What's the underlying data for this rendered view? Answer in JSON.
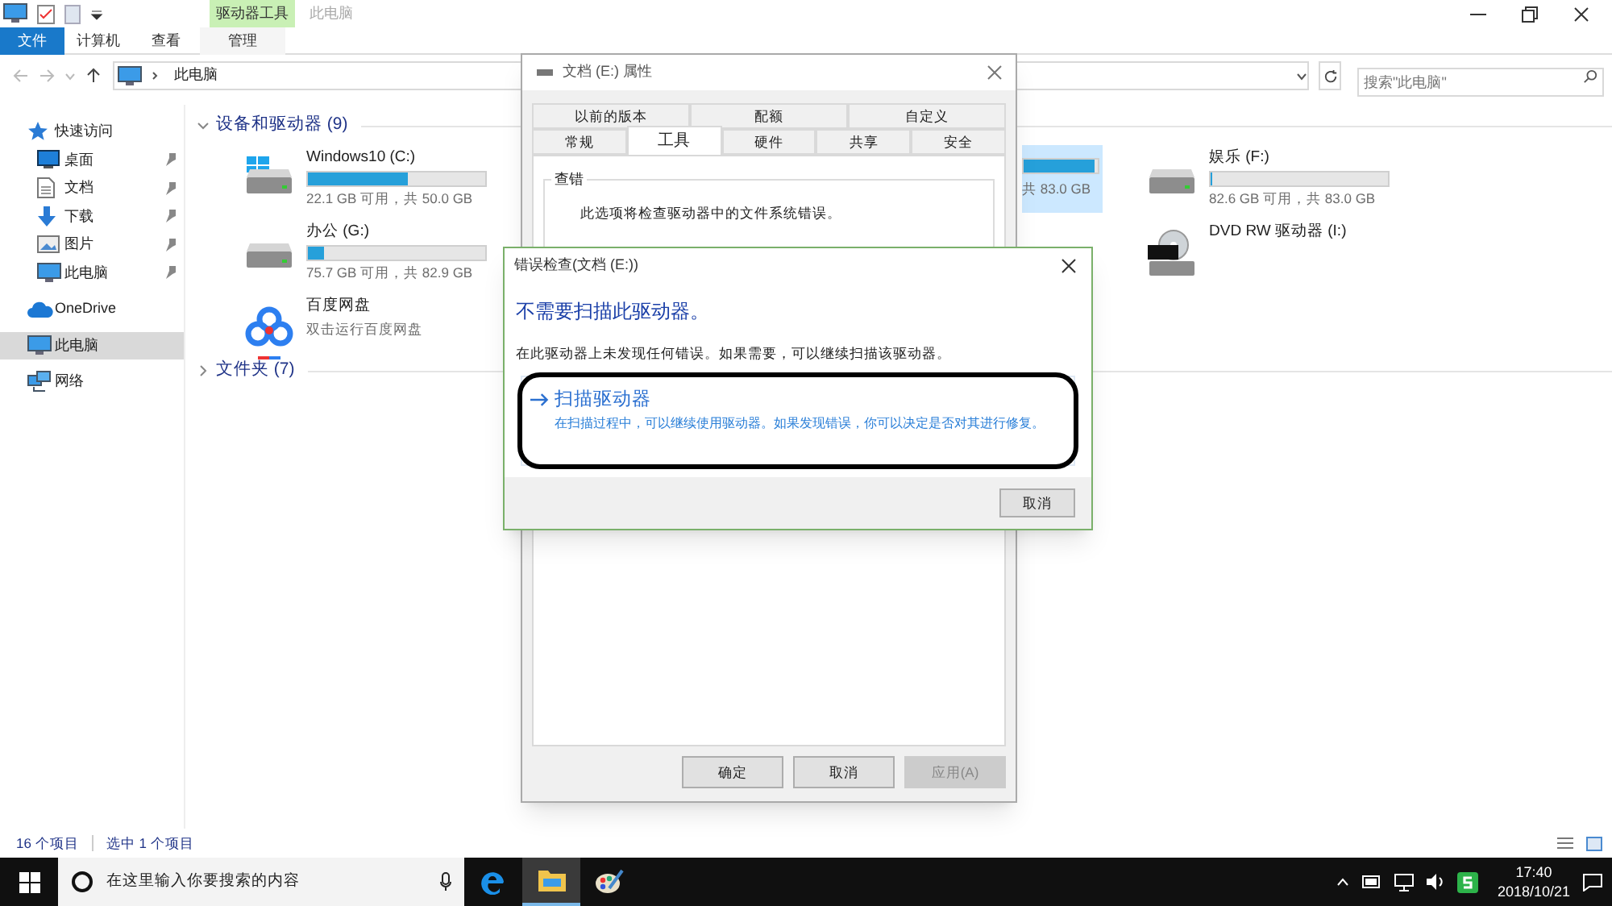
{
  "explorer": {
    "title": "此电脑",
    "context_tab": "驱动器工具",
    "ribbon_tabs": [
      {
        "label": "文件",
        "kind": "file",
        "selected": false
      },
      {
        "label": "计算机",
        "kind": "normal",
        "selected": false
      },
      {
        "label": "查看",
        "kind": "normal",
        "selected": false
      },
      {
        "label": "管理",
        "kind": "context",
        "selected": false
      }
    ],
    "address": "此电脑",
    "search_placeholder": "搜索\"此电脑\"",
    "sidebar": [
      {
        "label": "快速访问",
        "kind": "star",
        "pinned": false,
        "selected": false,
        "children": [
          {
            "label": "桌面",
            "kind": "desktop",
            "pinned": true,
            "selected": false
          },
          {
            "label": "文档",
            "kind": "doc",
            "pinned": true,
            "selected": false
          },
          {
            "label": "下载",
            "kind": "download",
            "pinned": true,
            "selected": false
          },
          {
            "label": "图片",
            "kind": "pictures",
            "pinned": true,
            "selected": false
          },
          {
            "label": "此电脑",
            "kind": "pc",
            "pinned": true,
            "selected": false
          }
        ]
      },
      {
        "label": "OneDrive",
        "kind": "cloud",
        "pinned": false,
        "selected": false
      },
      {
        "label": "此电脑",
        "kind": "pc",
        "pinned": false,
        "selected": true
      },
      {
        "label": "网络",
        "kind": "network",
        "pinned": false,
        "selected": false
      }
    ],
    "sections": [
      {
        "label": "设备和驱动器 (9)",
        "expanded": true
      },
      {
        "label": "文件夹 (7)",
        "expanded": false
      }
    ],
    "drive_columns": [
      [
        {
          "kind": "system",
          "name": "Windows10 (C:)",
          "level": 0.56,
          "info": "22.1 GB 可用，共 50.0 GB"
        },
        {
          "kind": "disk",
          "name": "办公 (G:)",
          "level": 0.09,
          "info": "75.7 GB 可用，共 82.9 GB"
        },
        {
          "kind": "app",
          "name": "百度网盘",
          "info": "双击运行百度网盘"
        }
      ],
      [
        {
          "kind": "fragment",
          "level": 0.95,
          "info": "共 83.0 GB",
          "selected": true
        }
      ],
      [
        {
          "kind": "disk",
          "name": "娱乐 (F:)",
          "level": 0.01,
          "info": "82.6 GB 可用，共 83.0 GB"
        },
        {
          "kind": "dvd",
          "name": "DVD RW 驱动器 (I:)"
        }
      ]
    ],
    "status": [
      "16 个项目",
      "选中 1 个项目"
    ]
  },
  "properties": {
    "title": "文档 (E:) 属性",
    "tab_rows": [
      [
        {
          "label": "以前的版本",
          "selected": false
        },
        {
          "label": "配额",
          "selected": false
        },
        {
          "label": "自定义",
          "selected": false
        }
      ],
      [
        {
          "label": "常规",
          "selected": false
        },
        {
          "label": "工具",
          "selected": true
        },
        {
          "label": "硬件",
          "selected": false
        },
        {
          "label": "共享",
          "selected": false
        },
        {
          "label": "安全",
          "selected": false
        }
      ]
    ],
    "group": "查错",
    "group_text": "此选项将检查驱动器中的文件系统错误。",
    "buttons": [
      {
        "label": "确定",
        "disabled": false
      },
      {
        "label": "取消",
        "disabled": false
      },
      {
        "label": "应用(A)",
        "disabled": true
      }
    ]
  },
  "error_check": {
    "title": "错误检查(文档 (E:))",
    "heading": "不需要扫描此驱动器。",
    "message": "在此驱动器上未发现任何错误。如果需要，可以继续扫描该驱动器。",
    "option": {
      "label": "扫描驱动器",
      "description": "在扫描过程中，可以继续使用驱动器。如果发现错误，你可以决定是否对其进行修复。"
    },
    "buttons": [
      {
        "label": "取消"
      }
    ]
  },
  "taskbar": {
    "search_placeholder": "在这里输入你要搜索的内容",
    "apps": [
      {
        "kind": "edge",
        "active": false
      },
      {
        "kind": "folder",
        "active": true
      },
      {
        "kind": "paint",
        "active": false
      }
    ],
    "time": "17:40",
    "date": "2018/10/21"
  }
}
